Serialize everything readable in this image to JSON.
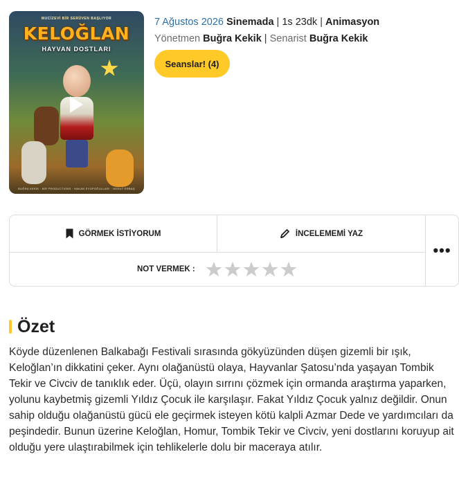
{
  "poster": {
    "topline": "MUCİZEVİ BİR SERÜVEN BAŞLIYOR",
    "title": "KELOĞLAN",
    "subtitle": "HAYVAN DOSTLARI",
    "bottomline": "BUĞRA KEKİK · BİR PRODUCTIONS · HAKAN EYÜPOĞULLARI · HOSUT ERBAŞ"
  },
  "meta": {
    "date": "7 Ağustos 2026",
    "status": "Sinemada",
    "sep": "|",
    "duration": "1s 23dk",
    "genre": "Animasyon",
    "director_label": "Yönetmen",
    "director": "Buğra Kekik",
    "writer_label": "Senarist",
    "writer": "Buğra Kekik"
  },
  "seans_button": "Seanslar! (4)",
  "actions": {
    "want_label": "GÖRMEK İSTİYORUM",
    "review_label": "İNCELEMEMİ YAZ",
    "more_label": "•••",
    "rating_label": "NOT VERMEK :",
    "rating_value": 0,
    "rating_max": 5
  },
  "summary": {
    "title": "Özet",
    "text": "Köyde düzenlenen Balkabağı Festivali sırasında gökyüzünden düşen gizemli bir ışık, Keloğlan’ın dikkatini çeker. Aynı olağanüstü olaya, Hayvanlar Şatosu’nda yaşayan Tombik Tekir ve Civciv de tanıklık eder. Üçü, olayın sırrını çözmek için ormanda araştırma yaparken, yolunu kaybetmiş gizemli Yıldız Çocuk ile karşılaşır. Fakat Yıldız Çocuk yalnız değildir. Onun sahip olduğu olağanüstü gücü ele geçirmek isteyen kötü kalpli Azmar Dede ve yardımcıları da peşindedir. Bunun üzerine Keloğlan, Homur, Tombik Tekir ve Civciv, yeni dostlarını koruyup ait olduğu yere ulaştırabilmek için tehlikelerle dolu bir maceraya atılır."
  },
  "colors": {
    "accent": "#ffc928",
    "date_link": "#2a6fa8",
    "star_empty": "#cccccc"
  }
}
